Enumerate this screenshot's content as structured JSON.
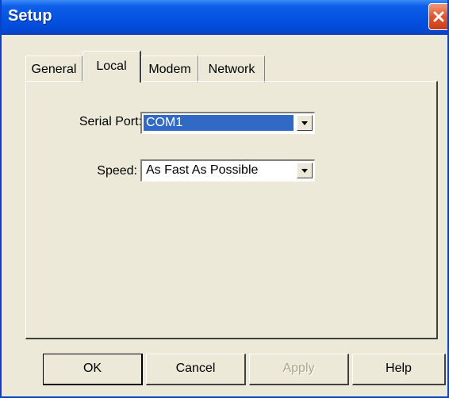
{
  "window": {
    "title": "Setup"
  },
  "tabs": [
    {
      "label": "General",
      "selected": false
    },
    {
      "label": "Local",
      "selected": true
    },
    {
      "label": "Modem",
      "selected": false
    },
    {
      "label": "Network",
      "selected": false
    }
  ],
  "local": {
    "serial_port": {
      "label": "Serial Port:",
      "value": "COM1"
    },
    "speed": {
      "label": "Speed:",
      "value": "As Fast As Possible"
    }
  },
  "buttons": {
    "ok": "OK",
    "cancel": "Cancel",
    "apply": "Apply",
    "help": "Help"
  },
  "colors": {
    "titlebar": "#0553e2",
    "face": "#ece9d8",
    "selection": "#316ac5",
    "close": "#e0562b"
  },
  "icons": {
    "close": "close-icon",
    "dropdown": "chevron-down-icon"
  }
}
